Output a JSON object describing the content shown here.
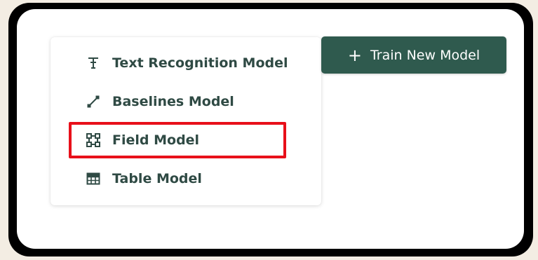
{
  "menu": {
    "items": [
      {
        "label": "Text Recognition Model",
        "icon": "text-recognition-icon"
      },
      {
        "label": "Baselines Model",
        "icon": "baselines-icon"
      },
      {
        "label": "Field Model",
        "icon": "field-icon"
      },
      {
        "label": "Table Model",
        "icon": "table-icon"
      }
    ],
    "highlighted_item": "Field Model"
  },
  "actions": {
    "train_button_icon": "plus-icon",
    "train_button_label": "Train New Model"
  },
  "colors": {
    "primary": "#2f5a4e",
    "menu_text": "#2f4a44",
    "highlight": "#e8101a"
  }
}
